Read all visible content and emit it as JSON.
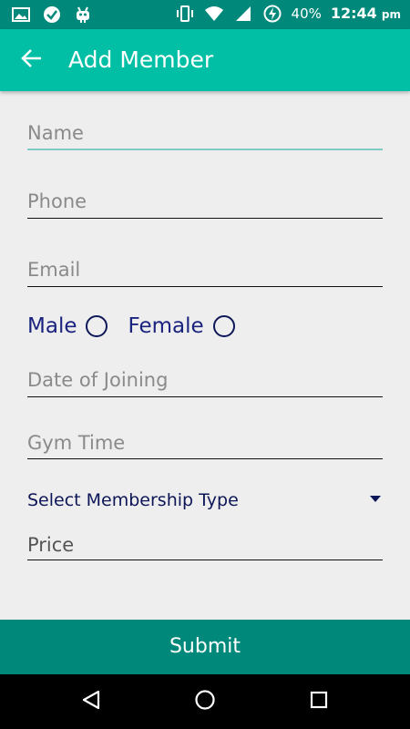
{
  "status_bar": {
    "battery": "40%",
    "time": "12:44",
    "ampm": "pm",
    "icons": [
      "gallery-icon",
      "check-icon",
      "android-icon",
      "vibrate-icon",
      "wifi-icon",
      "signal-icon",
      "battery-charging-icon"
    ]
  },
  "app_bar": {
    "title": "Add Member",
    "back_icon": "arrow-left-icon"
  },
  "form": {
    "name_placeholder": "Name",
    "phone_placeholder": "Phone",
    "email_placeholder": "Email",
    "gender": {
      "male_label": "Male",
      "female_label": "Female"
    },
    "doj_placeholder": "Date of Joining",
    "gym_time_placeholder": "Gym Time",
    "membership_type": "Select Membership Type",
    "price_value": "Price"
  },
  "submit_label": "Submit",
  "colors": {
    "status_bar": "#00897b",
    "app_bar": "#00bfa5",
    "submit": "#00897b",
    "accent_line": "#80cbc4",
    "label_navy": "#1a237e"
  }
}
